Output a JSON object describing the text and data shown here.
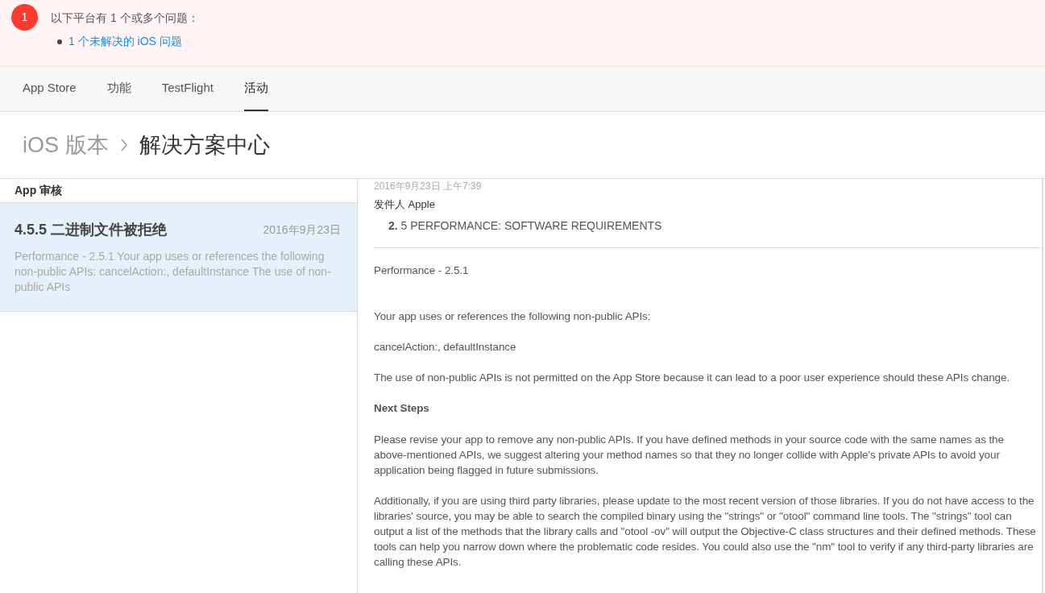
{
  "alert": {
    "count": "1",
    "message": "以下平台有 1 个或多个问题：",
    "links": [
      "1 个未解决的 iOS 问题"
    ]
  },
  "tabs": [
    {
      "label": "App Store",
      "selected": false
    },
    {
      "label": "功能",
      "selected": false
    },
    {
      "label": "TestFlight",
      "selected": false
    },
    {
      "label": "活动",
      "selected": true
    }
  ],
  "breadcrumb": [
    "iOS 版本",
    "解决方案中心"
  ],
  "sidebar": {
    "heading": "App 审核",
    "items": [
      {
        "title": "4.5.5 二进制文件被拒绝",
        "date": "2016年9月23日",
        "summary": "Performance - 2.5.1 Your app uses or references the following non-public APIs: cancelAction:, defaultInstance The use of non-public APIs",
        "selected": true
      }
    ]
  },
  "message": {
    "timestamp": "2016年9月23日 上午7:39",
    "sender": "发件人 Apple",
    "guideline": "**2.** 5 PERFORMANCE: SOFTWARE REQUIREMENTS",
    "body": [
      {
        "kind": "para",
        "text": "Performance - 2.5.1"
      },
      {
        "kind": "spacer"
      },
      {
        "kind": "para",
        "text": "Your app uses or references the following non-public APIs:"
      },
      {
        "kind": "para",
        "text": "cancelAction:, defaultInstance"
      },
      {
        "kind": "para",
        "text": "The use of non-public APIs is not permitted on the App Store because it can lead to a poor user experience should these APIs change."
      },
      {
        "kind": "heading",
        "text": "Next Steps"
      },
      {
        "kind": "para",
        "text": "Please revise your app to remove any non-public APIs. If you have defined methods in your source code with the same names as the above-mentioned APIs, we suggest altering your method names so that they no longer collide with Apple's private APIs to avoid your application being flagged in future submissions."
      },
      {
        "kind": "para",
        "text": "Additionally, if you are using third party libraries, please update to the most recent version of those libraries. If you do not have access to the libraries' source, you may be able to search the compiled binary using the \"strings\" or \"otool\" command line tools. The \"strings\" tool can output a list of the methods that the library calls and \"otool -ov\" will output the Objective-C class structures and their defined methods. These tools can help you narrow down where the problematic code resides. You could also use the \"nm\" tool to verify if any third-party libraries are calling these APIs."
      }
    ]
  }
}
